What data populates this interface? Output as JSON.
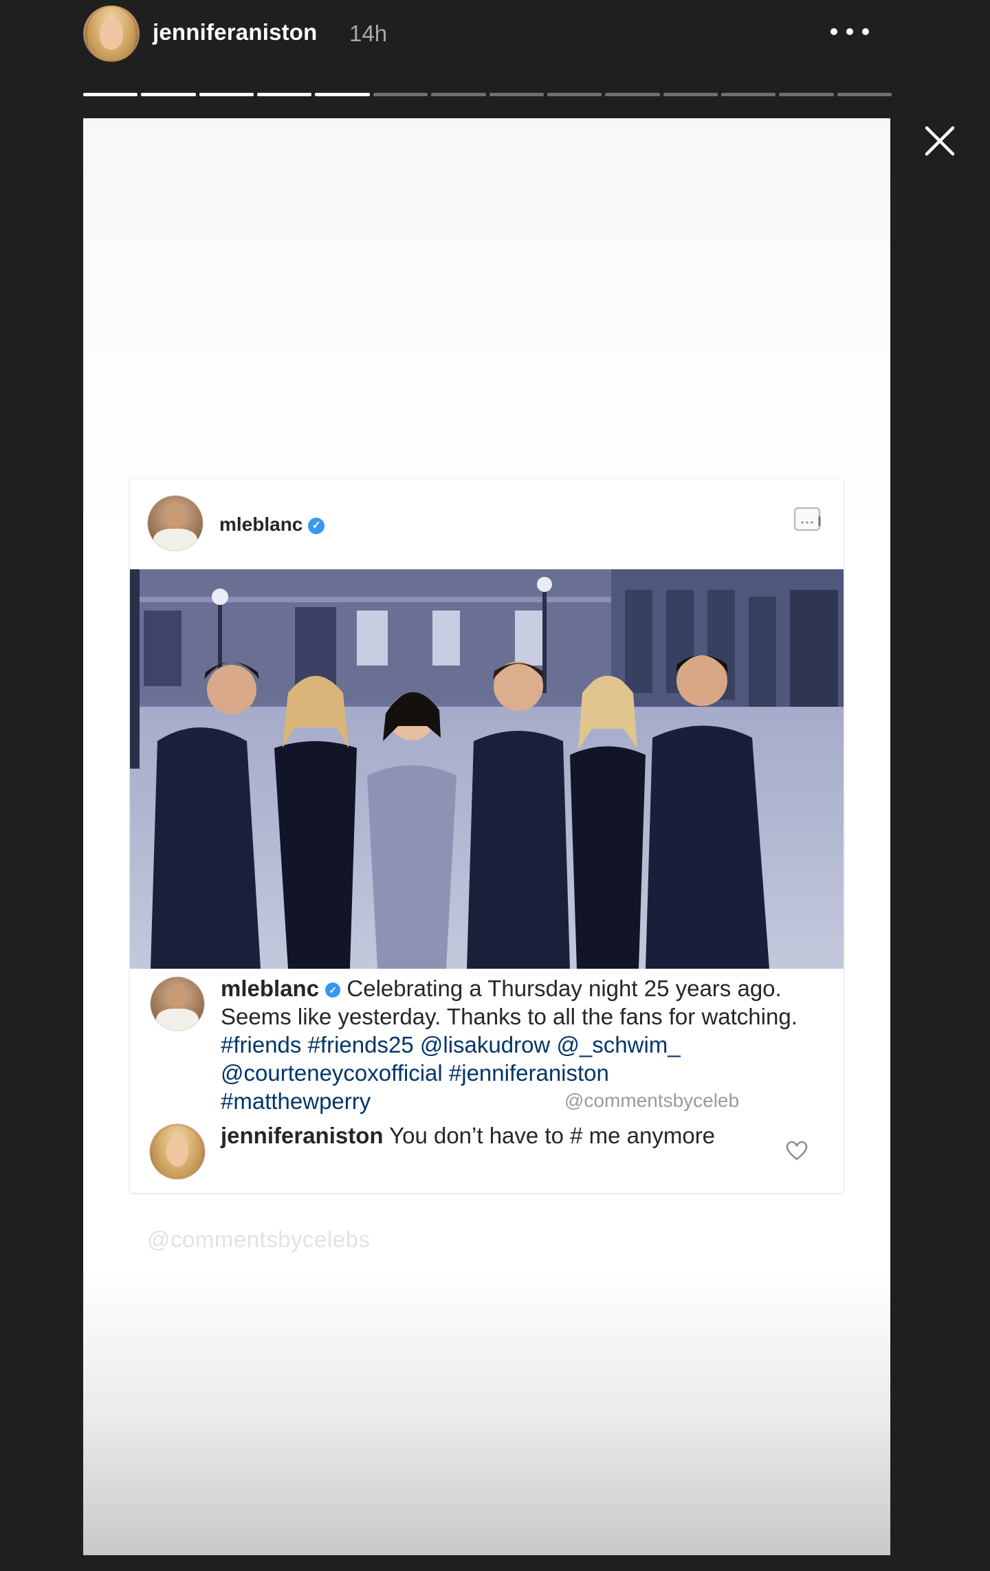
{
  "story": {
    "username": "jenniferaniston",
    "time": "14h",
    "segments_total": 14,
    "segments_viewed": 5,
    "more_icon": "more-horizontal-icon",
    "close_icon": "close-icon"
  },
  "post": {
    "username": "mleblanc",
    "verified_icon": "verified-badge-icon",
    "options_icon": "more-options-icon",
    "caption": {
      "author": "mleblanc",
      "text_1": "Celebrating a Thursday night 25 years ago. Seems like yesterday. Thanks to all the fans for watching.",
      "tags": [
        "#friends",
        "#friends25",
        "@lisakudrow",
        "@_schwim_",
        "@courteneycoxofficial",
        "#jenniferaniston",
        "#matthewperry"
      ]
    },
    "watermark_inline": "@commentsbyceleb",
    "comment": {
      "author": "jenniferaniston",
      "text": "You don’t have to # me anymore"
    },
    "heart_icon": "heart-icon"
  },
  "watermark_bottom": "@commentsbycelebs",
  "colors": {
    "background": "#1f1f20",
    "link": "#003569",
    "verified": "#3897f0"
  }
}
